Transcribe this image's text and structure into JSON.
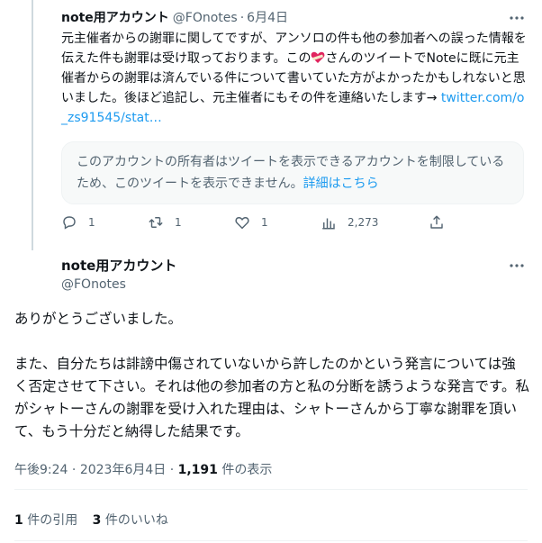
{
  "reply_tweet": {
    "display_name": "note用アカウント",
    "handle": "@FOnotes",
    "separator": "·",
    "date": "6月4日",
    "text_a": "元主催者からの謝罪に関してですが、アンソロの件も他の参加者への誤った情報を伝えた件も謝罪は受け取っております。この",
    "emoji": "heart-bandage",
    "text_b": "さんのツイートでNoteに既に元主催者からの謝罪は済んでいる件について書いていた方がよかったかもしれないと思いました。後ほど追記し、元主催者にもその件を連絡いたします→ ",
    "link": "twitter.com/o_zs91545/stat…"
  },
  "unavailable_notice": {
    "text": "このアカウントの所有者はツイートを表示できるアカウントを制限しているため、このツイートを表示できません。",
    "link": "詳細はこちら"
  },
  "actions": {
    "reply_count": "1",
    "retweet_count": "1",
    "like_count": "1",
    "view_count": "2,273"
  },
  "main_tweet": {
    "display_name": "note用アカウント",
    "handle": "@FOnotes",
    "paragraph1": "ありがとうございました。",
    "paragraph2": "また、自分たちは誹謗中傷されていないから許したのかという発言については強く否定させて下さい。それは他の参加者の方と私の分断を誘うような発言です。私がシャトーさんの謝罪を受け入れた理由は、シャトーさんから丁寧な謝罪を頂いて、もう十分だと納得した結果です。",
    "time": "午後9:24",
    "separator": "·",
    "date": "2023年6月4日",
    "views_separator": "·",
    "views": "1,191",
    "views_label": "件の表示",
    "quotes": "1",
    "quotes_label": "件の引用",
    "likes": "3",
    "likes_label": "件のいいね"
  },
  "colors": {
    "accent": "#1d9bf0",
    "secondary_text": "#536471",
    "heart_red": "#e0245e"
  }
}
